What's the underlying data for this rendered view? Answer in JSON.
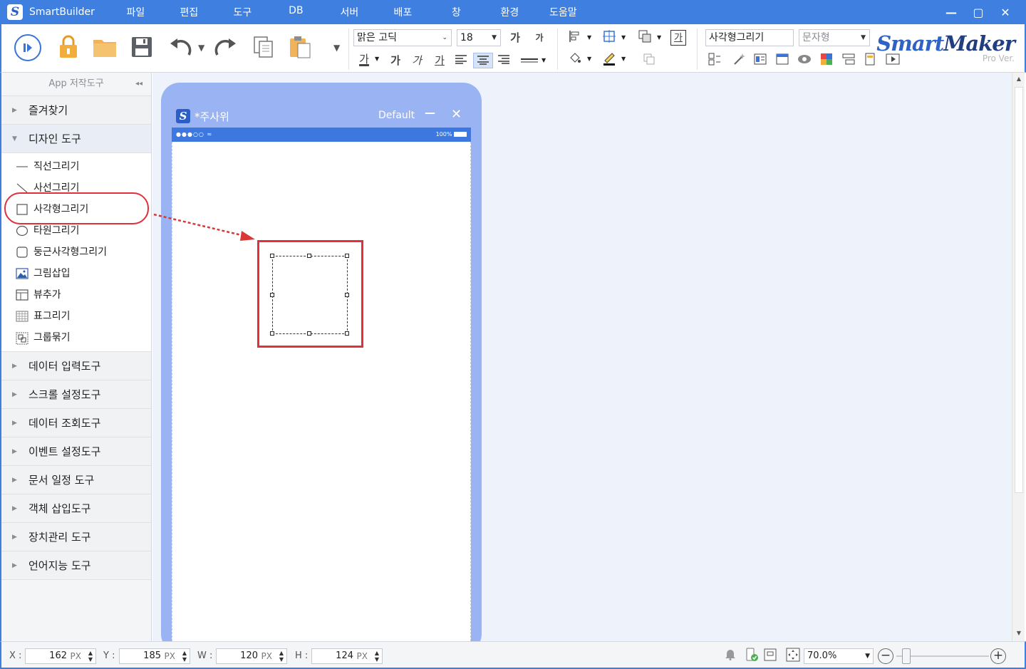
{
  "app": {
    "name": "SmartBuilder",
    "logo": "S"
  },
  "menu": [
    "파일",
    "편집",
    "도구",
    "DB",
    "서버",
    "배포",
    "창",
    "환경",
    "도움말"
  ],
  "window_controls": {
    "minimize": "—",
    "maximize": "▢",
    "close": "✕"
  },
  "toolbar": {
    "font_family": "맑은 고딕",
    "font_size": "18",
    "grow_font": "가",
    "shrink_font": "가",
    "text_color": "가",
    "bold": "가",
    "italic": "가",
    "underline": "가",
    "text_box": "가",
    "object_name": "사각형그리기",
    "object_type": "문자형"
  },
  "brand": {
    "name_a": "Smart",
    "name_b": "Maker",
    "version": "Pro Ver."
  },
  "sidebar": {
    "header": "App 저작도구",
    "collapse": "◂◂",
    "categories_top": [
      {
        "label": "즐겨찾기",
        "open": false
      },
      {
        "label": "디자인 도구",
        "open": true
      }
    ],
    "design_tools": [
      {
        "label": "직선그리기",
        "icon": "line-icon"
      },
      {
        "label": "사선그리기",
        "icon": "diagonal-line-icon"
      },
      {
        "label": "사각형그리기",
        "icon": "rectangle-icon"
      },
      {
        "label": "타원그리기",
        "icon": "ellipse-icon"
      },
      {
        "label": "둥근사각형그리기",
        "icon": "rounded-rectangle-icon"
      },
      {
        "label": "그림삽입",
        "icon": "image-icon"
      },
      {
        "label": "뷰추가",
        "icon": "view-icon"
      },
      {
        "label": "표그리기",
        "icon": "table-icon"
      },
      {
        "label": "그룹묶기",
        "icon": "group-icon"
      }
    ],
    "categories_bottom": [
      "데이터 입력도구",
      "스크롤 설정도구",
      "데이터 조회도구",
      "이벤트 설정도구",
      "문서 일정 도구",
      "객체 삽입도구",
      "장치관리 도구",
      "언어지능 도구"
    ]
  },
  "phone": {
    "title": "*주사위",
    "mode": "Default",
    "minimize": "—",
    "close": "✕",
    "signal": "●●●○○ ≈",
    "battery": "100%"
  },
  "statusbar": {
    "x_label": "X :",
    "x_value": "162",
    "y_label": "Y :",
    "y_value": "185",
    "w_label": "W :",
    "w_value": "120",
    "h_label": "H :",
    "h_value": "124",
    "unit": "PX",
    "zoom": "70.0%"
  },
  "colors": {
    "accent": "#3f7fe0",
    "highlight": "#e0303a",
    "phone_frame": "#9ab4f3",
    "canvas": "#eef3fb"
  }
}
